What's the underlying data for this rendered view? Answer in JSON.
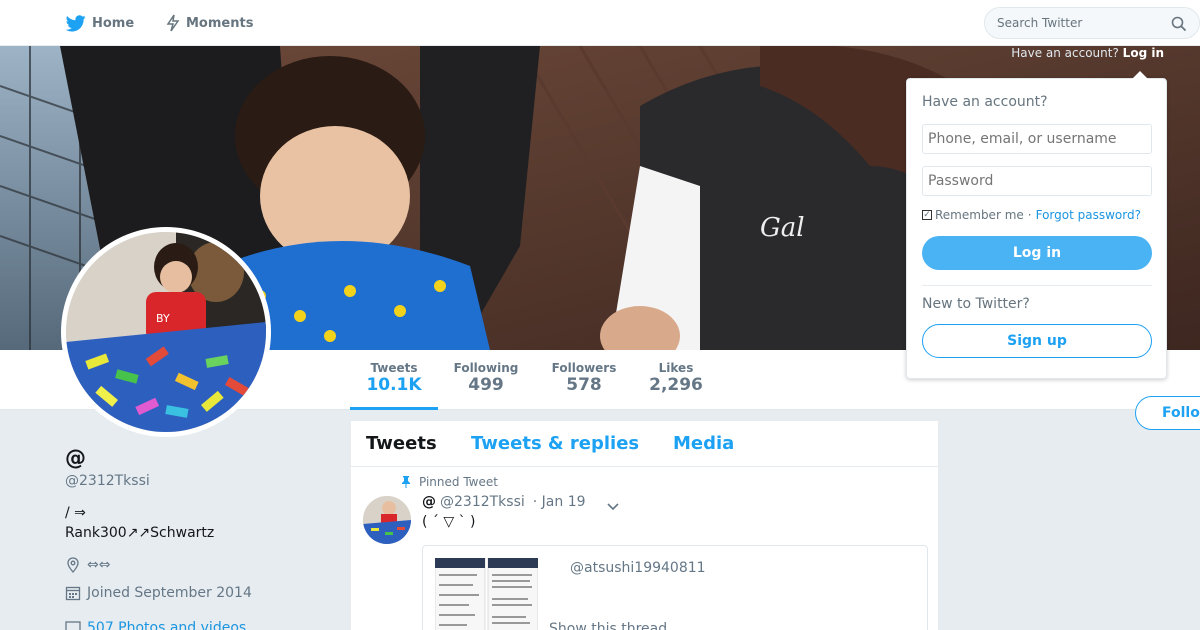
{
  "nav": {
    "home_label": "Home",
    "moments_label": "Moments",
    "search_placeholder": "Search Twitter"
  },
  "banner": {
    "login_hint_prefix": "Have an account?",
    "login_hint_link": "Log in"
  },
  "profile": {
    "name": "@",
    "handle": "@2312Tkssi",
    "bio_line1": "/ ⇒",
    "bio_line2": "Rank300↗↗Schwartz",
    "location": "⇔⇔",
    "joined": "Joined September 2014",
    "photos": "507 Photos and videos"
  },
  "stats": [
    {
      "label": "Tweets",
      "value": "10.1K"
    },
    {
      "label": "Following",
      "value": "499"
    },
    {
      "label": "Followers",
      "value": "578"
    },
    {
      "label": "Likes",
      "value": "2,296"
    }
  ],
  "follow_label": "Follow",
  "timeline": {
    "tabs": [
      "Tweets",
      "Tweets & replies",
      "Media"
    ],
    "pinned_label": "Pinned Tweet",
    "tweet": {
      "name": "@",
      "handle": "@2312Tkssi",
      "date": "· Jan 19",
      "text": "( ´ ▽ ` )",
      "quote_user": "@atsushi19940811",
      "show_thread": "Show this thread"
    }
  },
  "login_box": {
    "title": "Have an account?",
    "username_placeholder": "Phone, email, or username",
    "password_placeholder": "Password",
    "remember_label": "Remember me",
    "separator": "·",
    "forgot_label": "Forgot password?",
    "login_button": "Log in",
    "new_label": "New to Twitter?",
    "signup_button": "Sign up"
  },
  "colors": {
    "accent": "#1da1f2",
    "login_button": "#4ab3f4",
    "page_bg": "#e6ecf0"
  }
}
